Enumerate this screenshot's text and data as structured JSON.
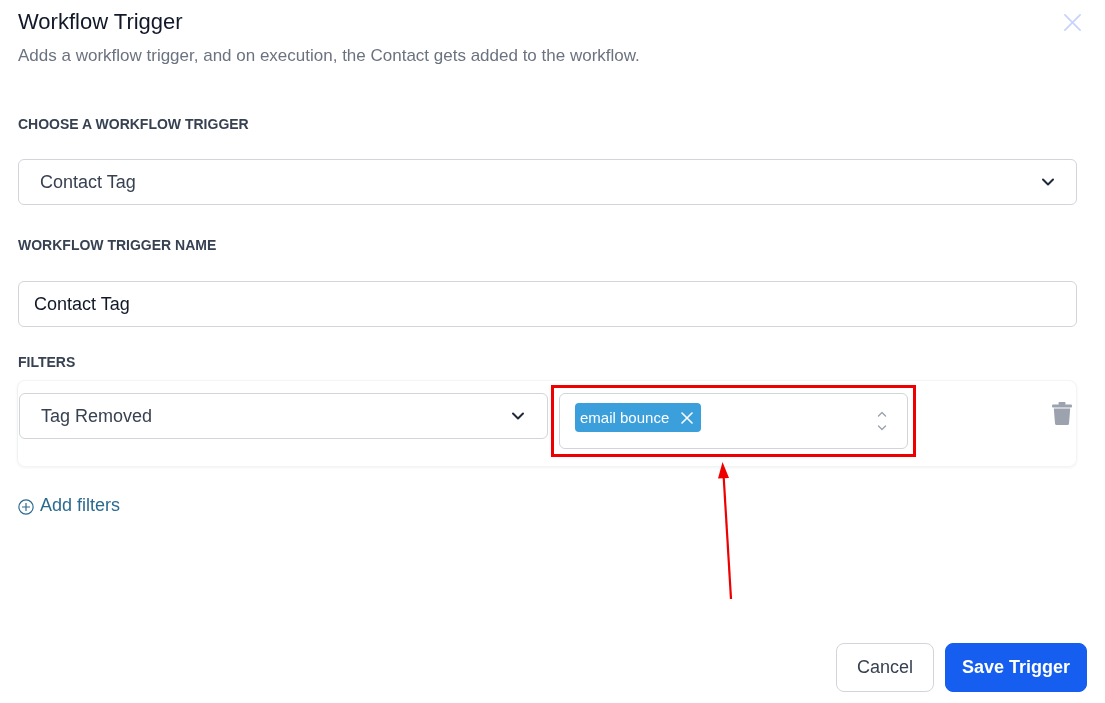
{
  "dialog": {
    "title": "Workflow Trigger",
    "description": "Adds a workflow trigger, and on execution, the Contact gets added to the workflow."
  },
  "trigger_select": {
    "label": "CHOOSE A WORKFLOW TRIGGER",
    "value": "Contact Tag"
  },
  "trigger_name": {
    "label": "WORKFLOW TRIGGER NAME",
    "value": "Contact Tag"
  },
  "filters": {
    "label": "FILTERS",
    "rows": [
      {
        "condition": "Tag Removed",
        "tags": [
          "email bounce"
        ],
        "highlighted": true
      }
    ],
    "add_button": "Add filters"
  },
  "buttons": [
    {
      "label": "Cancel",
      "kind": "secondary"
    },
    {
      "label": "Save Trigger",
      "kind": "primary"
    }
  ]
}
